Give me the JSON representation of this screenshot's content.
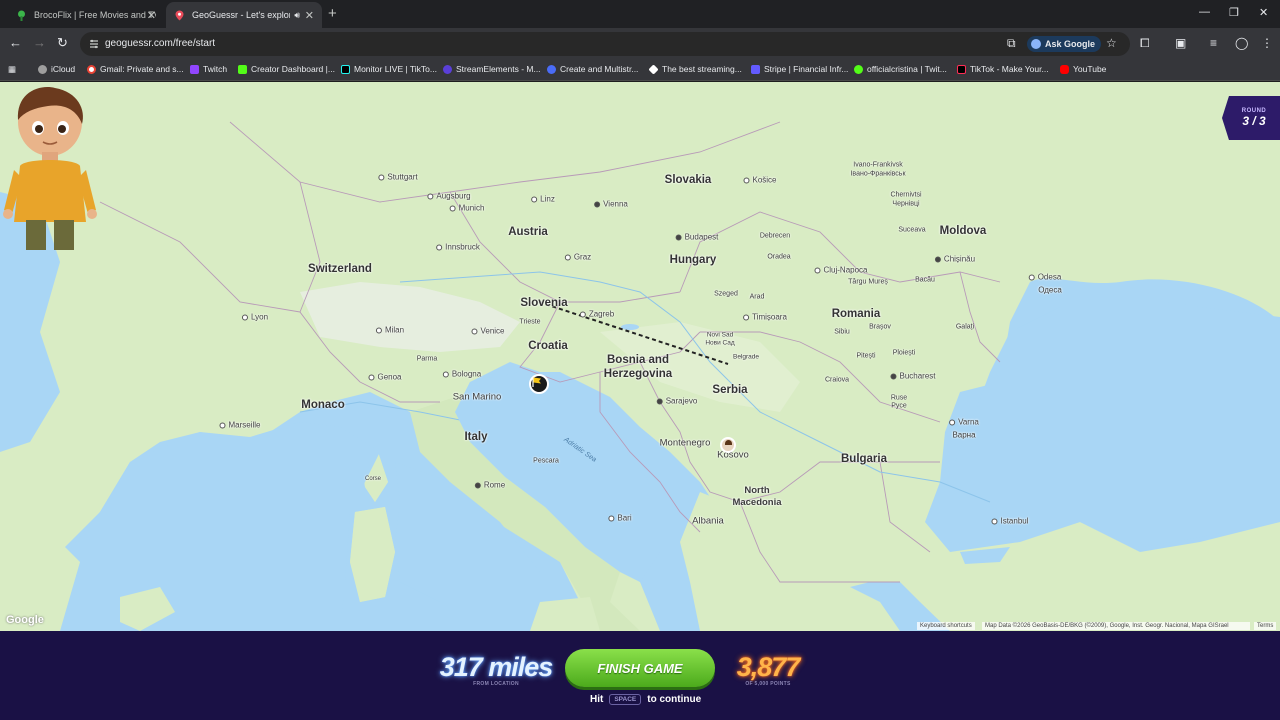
{
  "browser": {
    "tabs": [
      {
        "title": "BrocoFlix | Free Movies and TV",
        "active": false
      },
      {
        "title": "GeoGuessr - Let's explore t",
        "active": true
      }
    ],
    "url": "geoguessr.com/free/start",
    "ask_google": "Ask Google",
    "bookmarks": [
      {
        "label": "iCloud",
        "color": "#9e9e9e"
      },
      {
        "label": "Gmail: Private and s...",
        "color": "#ea4335"
      },
      {
        "label": "Twitch",
        "color": "#9146ff"
      },
      {
        "label": "Creator Dashboard |...",
        "color": "#53fc18"
      },
      {
        "label": "Monitor LIVE | TikTo...",
        "color": "#000000"
      },
      {
        "label": "StreamElements - M...",
        "color": "#5a3fd8"
      },
      {
        "label": "Create and Multistr...",
        "color": "#4a6cf7"
      },
      {
        "label": "The best streaming...",
        "color": "#ffffff"
      },
      {
        "label": "Stripe | Financial Infr...",
        "color": "#635bff"
      },
      {
        "label": "officialcristina | Twit...",
        "color": "#53fc18"
      },
      {
        "label": "TikTok - Make Your...",
        "color": "#000000"
      },
      {
        "label": "YouTube",
        "color": "#ff0000"
      }
    ]
  },
  "round": {
    "label": "ROUND",
    "value": "3 / 3"
  },
  "map": {
    "countries": [
      "Slovakia",
      "Austria",
      "Hungary",
      "Moldova",
      "Switzerland",
      "Slovenia",
      "Romania",
      "Croatia",
      "Bosnia and Herzegovina",
      "Serbia",
      "Monaco",
      "San Marino",
      "Italy",
      "Montenegro",
      "Kosovo",
      "Bulgaria",
      "North Macedonia",
      "Albania"
    ],
    "cities": [
      "Stuttgart",
      "Augsburg",
      "Munich",
      "Linz",
      "Vienna",
      "Košice",
      "Ivano-Frankivsk",
      "Івано-Франківськ",
      "Chernivtsi",
      "Чернівці",
      "Innsbruck",
      "Graz",
      "Budapest",
      "Debrecen",
      "Suceava",
      "Cluj-Napoca",
      "Târgu Mureș",
      "Chișinău",
      "Odesa",
      "Одеса",
      "Lyon",
      "Milan",
      "Venice",
      "Trieste",
      "Zagreb",
      "Szeged",
      "Arad",
      "Oradea",
      "Timișoara",
      "Bacău",
      "Galați",
      "Novi Sad",
      "Нови Сад",
      "Belgrade",
      "Sibiu",
      "Brașov",
      "Pitești",
      "Ploiești",
      "Genoa",
      "Parma",
      "Bologna",
      "Craiova",
      "Bucharest",
      "Ruse",
      "Русе",
      "Marseille",
      "Sarajevo",
      "Varna",
      "Варна",
      "Pescara",
      "Rome",
      "Bari",
      "Istanbul",
      "Corse"
    ],
    "seas": [
      "Adriatic Sea"
    ],
    "google_logo": "Google",
    "keyboard_shortcuts": "Keyboard shortcuts",
    "map_data": "Map Data ©2026 GeoBasis-DE/BKG (©2009), Google, Inst. Geogr. Nacional, Mapa GISrael",
    "terms": "Terms"
  },
  "result": {
    "distance": "317 miles",
    "distance_sub": "FROM LOCATION",
    "finish_label": "FINISH GAME",
    "hint_before": "Hit",
    "hint_key": "SPACE",
    "hint_after": "to continue",
    "points": "3,877",
    "points_sub": "OF 5,000 POINTS"
  }
}
